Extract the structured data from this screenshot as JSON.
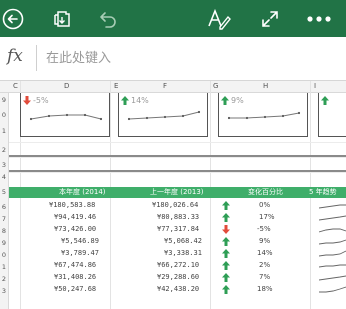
{
  "toolbar": {
    "back_icon": "back-circle-icon",
    "save_icon": "save-icon",
    "undo_icon": "undo-icon",
    "format_icon": "text-format-icon",
    "fullscreen_icon": "expand-icon",
    "more_icon": "more-icon",
    "color": "#217346"
  },
  "formula_bar": {
    "fx_label": "fx",
    "placeholder": "在此处键入"
  },
  "grid": {
    "columns": [
      "C",
      "D",
      "E",
      "F",
      "G",
      "H",
      "I"
    ],
    "rows": [
      "9",
      "0",
      "1",
      "2",
      "3",
      "4",
      "5",
      "6",
      "7",
      "8",
      "9",
      "0",
      "1",
      "2",
      "3"
    ]
  },
  "cards": [
    {
      "pct": "-5%",
      "trend": "down"
    },
    {
      "pct": "14%",
      "trend": "up"
    },
    {
      "pct": "9%",
      "trend": "up"
    }
  ],
  "table": {
    "headers": [
      "本年度 (2014)",
      "上一年度 (2013)",
      "变化百分比",
      "5 年趋势"
    ],
    "rows": [
      {
        "current": "¥180,583.88",
        "previous": "¥180,026.64",
        "change": "0%",
        "trend": "up"
      },
      {
        "current": "¥94,419.46",
        "previous": "¥80,883.33",
        "change": "17%",
        "trend": "up"
      },
      {
        "current": "¥73,426.00",
        "previous": "¥77,317.84",
        "change": "-5%",
        "trend": "down"
      },
      {
        "current": "¥5,546.89",
        "previous": "¥5,068.42",
        "change": "9%",
        "trend": "up"
      },
      {
        "current": "¥3,789.47",
        "previous": "¥3,338.31",
        "change": "14%",
        "trend": "up"
      },
      {
        "current": "¥67,474.86",
        "previous": "¥66,272.10",
        "change": "2%",
        "trend": "up"
      },
      {
        "current": "¥31,408.26",
        "previous": "¥29,288.60",
        "change": "7%",
        "trend": "up"
      },
      {
        "current": "¥50,247.68",
        "previous": "¥42,438.20",
        "change": "18%",
        "trend": "up"
      }
    ]
  },
  "colors": {
    "header_green": "#3fae6a",
    "up_arrow": "#2e9e55",
    "down_arrow": "#e24b3b"
  }
}
